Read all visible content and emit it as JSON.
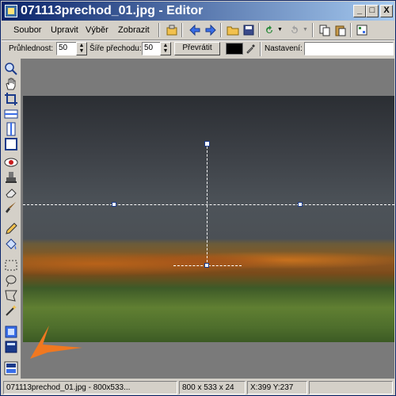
{
  "window": {
    "title": "071113prechod_01.jpg - Editor"
  },
  "title_buttons": {
    "minimize": "_",
    "maximize": "□",
    "close": "X"
  },
  "menu": {
    "items": [
      {
        "label": "Soubor"
      },
      {
        "label": "Upravit"
      },
      {
        "label": "Výběr"
      },
      {
        "label": "Zobrazit"
      }
    ]
  },
  "toolbar_icons": [
    "select-icon",
    "undo-arrow-icon",
    "redo-arrow-icon",
    "open-folder-icon",
    "save-icon",
    "rotate-icon",
    "rotate-dropdown-icon",
    "redo-icon",
    "redo-dropdown-icon",
    "copy-icon",
    "paste-icon",
    "settings-icon"
  ],
  "options": {
    "opacity_label": "Průhlednost:",
    "opacity_value": "50",
    "width_label": "Šíře přechodu:",
    "width_value": "50",
    "invert_label": "Převrátit",
    "color": "#000000",
    "settings_label": "Nastavení:",
    "settings_value": ""
  },
  "tools": [
    "zoom-icon",
    "hand-icon",
    "crop-icon",
    "horizontal-gradient-icon",
    "vertical-gradient-icon",
    "free-gradient-icon",
    "red-eye-icon",
    "clone-stamp-icon",
    "eraser-icon",
    "brush-icon",
    "pencil-icon",
    "fill-icon",
    "rect-select-icon",
    "lasso-icon",
    "poly-select-icon",
    "magic-wand-icon",
    "layers-icon",
    "panel-icon",
    "image-props-icon"
  ],
  "status": {
    "file": "071113prechod_01.jpg - 800x533...",
    "dims": "800 x 533 x 24",
    "coords": "X:399  Y:237"
  },
  "colors": {
    "title_start": "#0a246a",
    "title_end": "#a6caf0",
    "accent_arrow": "#f07820"
  }
}
